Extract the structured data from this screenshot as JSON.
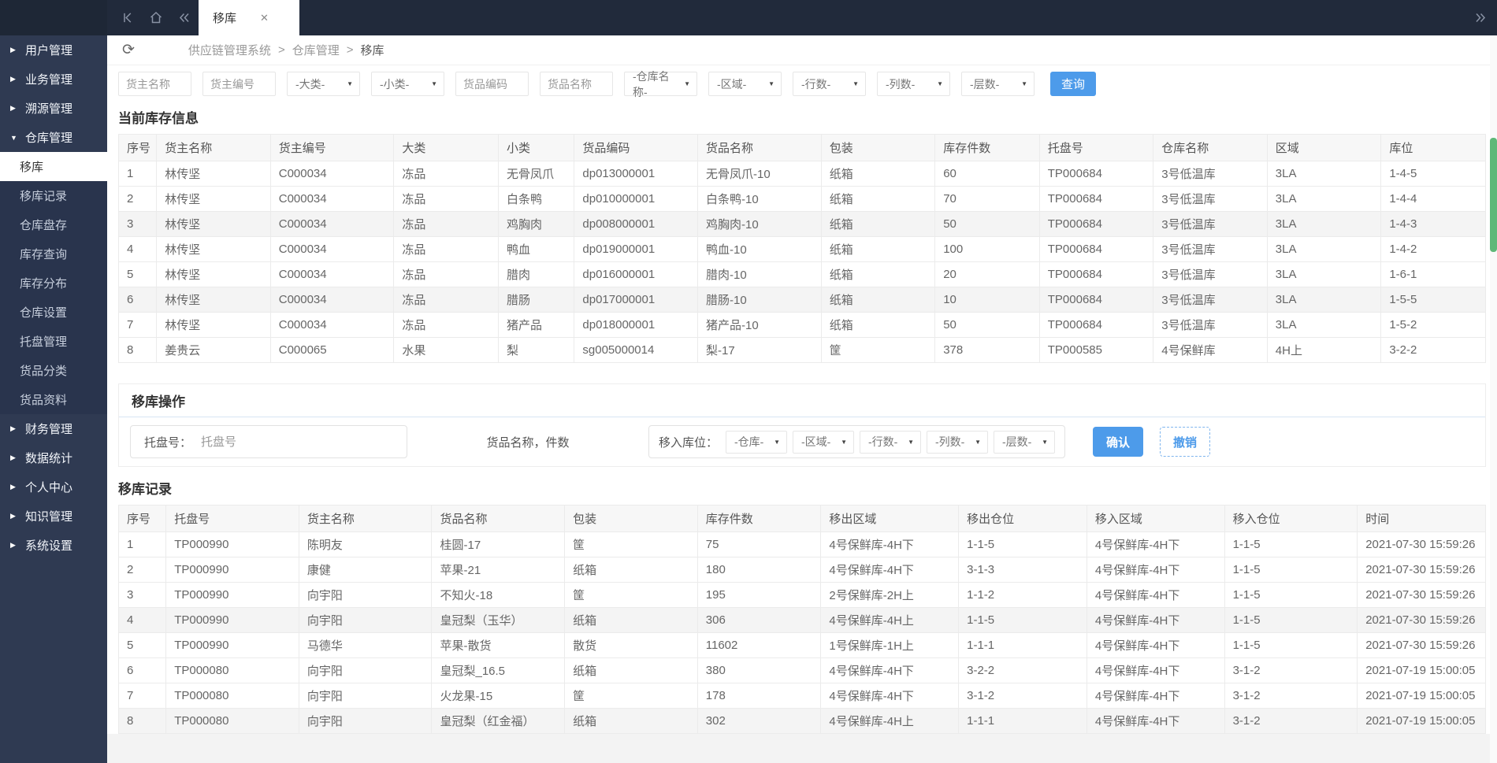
{
  "colors": {
    "accent_blue": "#4D9BEA",
    "scrollbar_green": "#5FB878",
    "topbar_bg": "#212A3B",
    "sidebar_bg": "#2F3A52",
    "submenu_bg": "#29344D"
  },
  "icons": {
    "refresh": "⟳",
    "tab_close": "✕",
    "select_arrow": "▼",
    "caret_collapsed": "▶",
    "caret_expanded": "▼"
  },
  "topbar": {
    "tab_label": "移库"
  },
  "breadcrumb": {
    "separator": ">",
    "items": [
      "供应链管理系统",
      "仓库管理",
      "移库"
    ]
  },
  "sidebar": {
    "top_groups": [
      "用户管理",
      "业务管理",
      "溯源管理",
      "仓库管理"
    ],
    "warehouse_children": [
      "移库",
      "移库记录",
      "仓库盘存",
      "库存查询",
      "库存分布",
      "仓库设置",
      "托盘管理",
      "货品分类",
      "货品资料"
    ],
    "active_child": "移库",
    "bottom_groups": [
      "财务管理",
      "数据统计",
      "个人中心",
      "知识管理",
      "系统设置"
    ]
  },
  "filters": {
    "owner_name_ph": "货主名称",
    "owner_code_ph": "货主编号",
    "category_select": "-大类-",
    "subcategory_select": "-小类-",
    "goods_code_ph": "货品编码",
    "goods_name_ph": "货品名称",
    "warehouse_select": "-仓库名称-",
    "region_select": "-区域-",
    "rows_select": "-行数-",
    "cols_select": "-列数-",
    "layers_select": "-层数-",
    "search_label": "查询"
  },
  "inventory": {
    "title": "当前库存信息",
    "columns": [
      "序号",
      "货主名称",
      "货主编号",
      "大类",
      "小类",
      "货品编码",
      "货品名称",
      "包装",
      "库存件数",
      "托盘号",
      "仓库名称",
      "区域",
      "库位"
    ],
    "rows": [
      [
        "1",
        "林传坚",
        "C000034",
        "冻品",
        "无骨凤爪",
        "dp013000001",
        "无骨凤爪-10",
        "纸箱",
        "60",
        "TP000684",
        "3号低温库",
        "3LA",
        "1-4-5"
      ],
      [
        "2",
        "林传坚",
        "C000034",
        "冻品",
        "白条鸭",
        "dp010000001",
        "白条鸭-10",
        "纸箱",
        "70",
        "TP000684",
        "3号低温库",
        "3LA",
        "1-4-4"
      ],
      [
        "3",
        "林传坚",
        "C000034",
        "冻品",
        "鸡胸肉",
        "dp008000001",
        "鸡胸肉-10",
        "纸箱",
        "50",
        "TP000684",
        "3号低温库",
        "3LA",
        "1-4-3"
      ],
      [
        "4",
        "林传坚",
        "C000034",
        "冻品",
        "鸭血",
        "dp019000001",
        "鸭血-10",
        "纸箱",
        "100",
        "TP000684",
        "3号低温库",
        "3LA",
        "1-4-2"
      ],
      [
        "5",
        "林传坚",
        "C000034",
        "冻品",
        "腊肉",
        "dp016000001",
        "腊肉-10",
        "纸箱",
        "20",
        "TP000684",
        "3号低温库",
        "3LA",
        "1-6-1"
      ],
      [
        "6",
        "林传坚",
        "C000034",
        "冻品",
        "腊肠",
        "dp017000001",
        "腊肠-10",
        "纸箱",
        "10",
        "TP000684",
        "3号低温库",
        "3LA",
        "1-5-5"
      ],
      [
        "7",
        "林传坚",
        "C000034",
        "冻品",
        "猪产品",
        "dp018000001",
        "猪产品-10",
        "纸箱",
        "50",
        "TP000684",
        "3号低温库",
        "3LA",
        "1-5-2"
      ],
      [
        "8",
        "姜贵云",
        "C000065",
        "水果",
        "梨",
        "sg005000014",
        "梨-17",
        "筐",
        "378",
        "TP000585",
        "4号保鲜库",
        "4H上",
        "3-2-2"
      ]
    ]
  },
  "operation": {
    "title": "移库操作",
    "pallet_label": "托盘号：",
    "pallet_ph": "托盘号",
    "middle_text": "货品名称，件数",
    "target_label": "移入库位：",
    "warehouse_select": "-仓库-",
    "region_select": "-区域-",
    "rows_select": "-行数-",
    "cols_select": "-列数-",
    "layers_select": "-层数-",
    "confirm_label": "确认",
    "undo_label": "撤销"
  },
  "records": {
    "title": "移库记录",
    "columns": [
      "序号",
      "托盘号",
      "货主名称",
      "货品名称",
      "包装",
      "库存件数",
      "移出区域",
      "移出仓位",
      "移入区域",
      "移入仓位",
      "时间"
    ],
    "rows": [
      [
        "1",
        "TP000990",
        "陈明友",
        "桂圆-17",
        "筐",
        "75",
        "4号保鲜库-4H下",
        "1-1-5",
        "4号保鲜库-4H下",
        "1-1-5",
        "2021-07-30 15:59:26"
      ],
      [
        "2",
        "TP000990",
        "康健",
        "苹果-21",
        "纸箱",
        "180",
        "4号保鲜库-4H下",
        "3-1-3",
        "4号保鲜库-4H下",
        "1-1-5",
        "2021-07-30 15:59:26"
      ],
      [
        "3",
        "TP000990",
        "向宇阳",
        "不知火-18",
        "筐",
        "195",
        "2号保鲜库-2H上",
        "1-1-2",
        "4号保鲜库-4H下",
        "1-1-5",
        "2021-07-30 15:59:26"
      ],
      [
        "4",
        "TP000990",
        "向宇阳",
        "皇冠梨（玉华）",
        "纸箱",
        "306",
        "4号保鲜库-4H上",
        "1-1-5",
        "4号保鲜库-4H下",
        "1-1-5",
        "2021-07-30 15:59:26"
      ],
      [
        "5",
        "TP000990",
        "马德华",
        "苹果-散货",
        "散货",
        "11602",
        "1号保鲜库-1H上",
        "1-1-1",
        "4号保鲜库-4H下",
        "1-1-5",
        "2021-07-30 15:59:26"
      ],
      [
        "6",
        "TP000080",
        "向宇阳",
        "皇冠梨_16.5",
        "纸箱",
        "380",
        "4号保鲜库-4H下",
        "3-2-2",
        "4号保鲜库-4H下",
        "3-1-2",
        "2021-07-19 15:00:05"
      ],
      [
        "7",
        "TP000080",
        "向宇阳",
        "火龙果-15",
        "筐",
        "178",
        "4号保鲜库-4H下",
        "3-1-2",
        "4号保鲜库-4H下",
        "3-1-2",
        "2021-07-19 15:00:05"
      ],
      [
        "8",
        "TP000080",
        "向宇阳",
        "皇冠梨（红金福）",
        "纸箱",
        "302",
        "4号保鲜库-4H上",
        "1-1-1",
        "4号保鲜库-4H下",
        "3-1-2",
        "2021-07-19 15:00:05"
      ]
    ]
  }
}
